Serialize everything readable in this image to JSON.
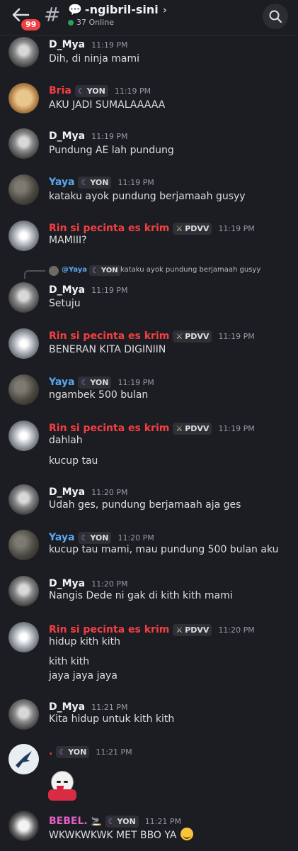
{
  "header": {
    "badge": "99",
    "channel": "-ngibril-sini",
    "online": "37 Online"
  },
  "reply": {
    "name": "@Yaya",
    "tag": "YON",
    "text": "kataku ayok pundung berjamaah gusyy"
  },
  "messages": [
    {
      "name": "D_Mya",
      "time": "11:19 PM",
      "lines": [
        "Dih, di ninja mami"
      ]
    },
    {
      "name": "Bria",
      "tag": "YON",
      "time": "11:19 PM",
      "lines": [
        "AKU JADI SUMALAAAAA"
      ]
    },
    {
      "name": "D_Mya",
      "time": "11:19 PM",
      "lines": [
        "Pundung AE lah pundung"
      ]
    },
    {
      "name": "Yaya",
      "tag": "YON",
      "time": "11:19 PM",
      "lines": [
        "kataku ayok pundung berjamaah gusyy"
      ]
    },
    {
      "name": "Rin si pecinta es krim",
      "tag": "PDVV",
      "time": "11:19 PM",
      "lines": [
        "MAMIII?"
      ]
    },
    {
      "name": "D_Mya",
      "time": "11:19 PM",
      "lines": [
        "Setuju"
      ]
    },
    {
      "name": "Rin si pecinta es krim",
      "tag": "PDVV",
      "time": "11:19 PM",
      "lines": [
        "BENERAN KITA DIGINIIN"
      ]
    },
    {
      "name": "Yaya",
      "tag": "YON",
      "time": "11:19 PM",
      "lines": [
        "ngambek 500 bulan"
      ]
    },
    {
      "name": "Rin si pecinta es krim",
      "tag": "PDVV",
      "time": "11:19 PM",
      "lines": [
        "dahlah",
        "kucup tau"
      ]
    },
    {
      "name": "D_Mya",
      "time": "11:20 PM",
      "lines": [
        "Udah ges, pundung berjamaah aja ges"
      ]
    },
    {
      "name": "Yaya",
      "tag": "YON",
      "time": "11:20 PM",
      "lines": [
        "kucup tau mami, mau pundung 500 bulan aku"
      ]
    },
    {
      "name": "D_Mya",
      "time": "11:20 PM",
      "lines": [
        "Nangis Dede ni gak di kith kith mami"
      ]
    },
    {
      "name": "Rin si pecinta es krim",
      "tag": "PDVV",
      "time": "11:20 PM",
      "lines": [
        "hidup kith kith",
        "kith kith",
        "jaya jaya jaya"
      ]
    },
    {
      "name": "D_Mya",
      "time": "11:21 PM",
      "lines": [
        "Kita hidup untuk kith kith"
      ]
    },
    {
      "name": ".",
      "tag": "YON",
      "time": "11:21 PM",
      "lines": []
    },
    {
      "name": "BEBEL.",
      "tag": "YON",
      "time": "11:21 PM",
      "lines": [
        "WKWKWKWK MET BBO YA"
      ]
    }
  ],
  "colors": {
    "background": "#1c1d22",
    "red": "#f23f43",
    "blue": "#5aa8f0",
    "pink": "#e35fc3",
    "online": "#23a55a"
  },
  "icons": [
    "back-arrow-icon",
    "hash-icon",
    "speech-bubble-icon",
    "chevron-right-icon",
    "search-icon",
    "moon-icon",
    "sword-icon",
    "cigarette-icon"
  ]
}
